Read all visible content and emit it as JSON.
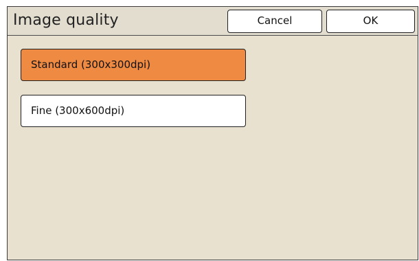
{
  "dialog": {
    "title": "Image quality",
    "cancel_label": "Cancel",
    "ok_label": "OK"
  },
  "options": [
    {
      "label": "Standard (300x300dpi)",
      "selected": true
    },
    {
      "label": "Fine (300x600dpi)",
      "selected": false
    }
  ],
  "colors": {
    "background": "#e8e1d0",
    "selected_fill": "#ef8a43",
    "unselected_fill": "#ffffff",
    "border": "#1f1f1f"
  }
}
